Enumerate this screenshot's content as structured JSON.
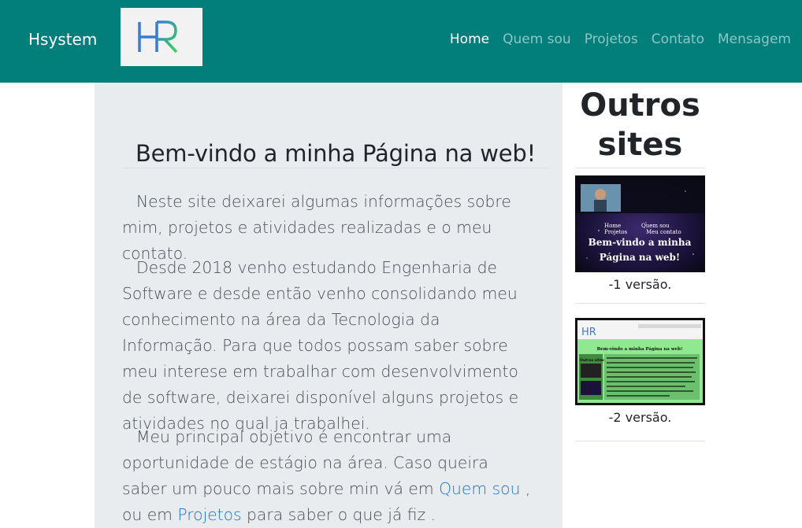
{
  "navbar": {
    "brand": "Hsystem",
    "logo_text": "HR",
    "items": [
      {
        "label": "Home",
        "active": true
      },
      {
        "label": "Quem sou",
        "active": false
      },
      {
        "label": "Projetos",
        "active": false
      },
      {
        "label": "Contato",
        "active": false
      },
      {
        "label": "Mensagem",
        "active": false
      }
    ]
  },
  "main": {
    "title": "Bem-vindo a minha Página na web!",
    "p1": "Neste site deixarei algumas informações sobre mim, projetos e atividades realizadas e o meu contato.",
    "p2": "Desde 2018 venho estudando Engenharia de Software e desde então venho consolidando meu conhecimento na área da Tecnologia da Informação. Para que todos possam saber sobre meu interese em trabalhar com desenvolvimento de software, deixarei disponível alguns projetos e atividades no qual ja trabalhei.",
    "p3_before": "Meu principal objetivo é encontrar uma oportunidade de estágio na área. Caso queira saber um pouco mais sobre min vá em ",
    "p3_link1": "Quem sou",
    "p3_middle": " , ou em ",
    "p3_link2": "Projetos",
    "p3_after": " para saber o que já fiz ."
  },
  "aside": {
    "title_line1": "Outros",
    "title_line2": "sites",
    "sites": [
      {
        "caption": "-1 versão.",
        "thumb_nav": [
          "Home",
          "Quem sou",
          "Projetos",
          "Meu contato"
        ],
        "thumb_title_line1": "Bem-vindo a minha",
        "thumb_title_line2": "Página na web!"
      },
      {
        "caption": "-2 versão.",
        "thumb_title": "Bem-vindo a minha Página na web!",
        "thumb_side_title": "Outros sites",
        "thumb_logo": "HR"
      }
    ]
  },
  "colors": {
    "navbar": "#027e7b",
    "main_bg": "#e9ecef",
    "link": "#1a73d9",
    "thumb2_bg": "#90e890"
  }
}
